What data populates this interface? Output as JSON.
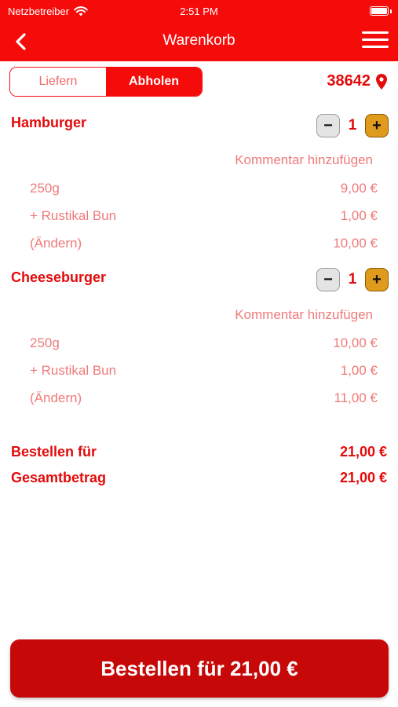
{
  "status_bar": {
    "carrier": "Netzbetreiber",
    "time": "2:51 PM"
  },
  "nav": {
    "title": "Warenkorb"
  },
  "mode_toggle": {
    "options": [
      "Liefern",
      "Abholen"
    ],
    "selected": "Abholen"
  },
  "location": {
    "postal_code": "38642"
  },
  "cart": {
    "items": [
      {
        "name": "Hamburger",
        "quantity": "1",
        "comment_label": "Kommentar hinzufügen",
        "lines": [
          {
            "label": "250g",
            "price": "9,00 €"
          },
          {
            "label": "+ Rustikal Bun",
            "price": "1,00 €"
          },
          {
            "label": "(Ändern)",
            "price": "10,00 €"
          }
        ]
      },
      {
        "name": "Cheeseburger",
        "quantity": "1",
        "comment_label": "Kommentar hinzufügen",
        "lines": [
          {
            "label": "250g",
            "price": "10,00 €"
          },
          {
            "label": "+ Rustikal Bun",
            "price": "1,00 €"
          },
          {
            "label": "(Ändern)",
            "price": "11,00 €"
          }
        ]
      }
    ]
  },
  "totals": {
    "order_label": "Bestellen für",
    "order_value": "21,00 €",
    "total_label": "Gesamtbetrag",
    "total_value": "21,00 €"
  },
  "order_button": {
    "label": "Bestellen für 21,00 €"
  },
  "colors": {
    "brand_red": "#f60b0b",
    "button_red": "#c70808",
    "plus_orange": "#e09a1c",
    "muted_red": "#f07a7a"
  },
  "icons": [
    "wifi-icon",
    "battery-icon",
    "back-arrow-icon",
    "hamburger-menu-icon",
    "location-pin-icon",
    "minus-icon",
    "plus-icon"
  ]
}
